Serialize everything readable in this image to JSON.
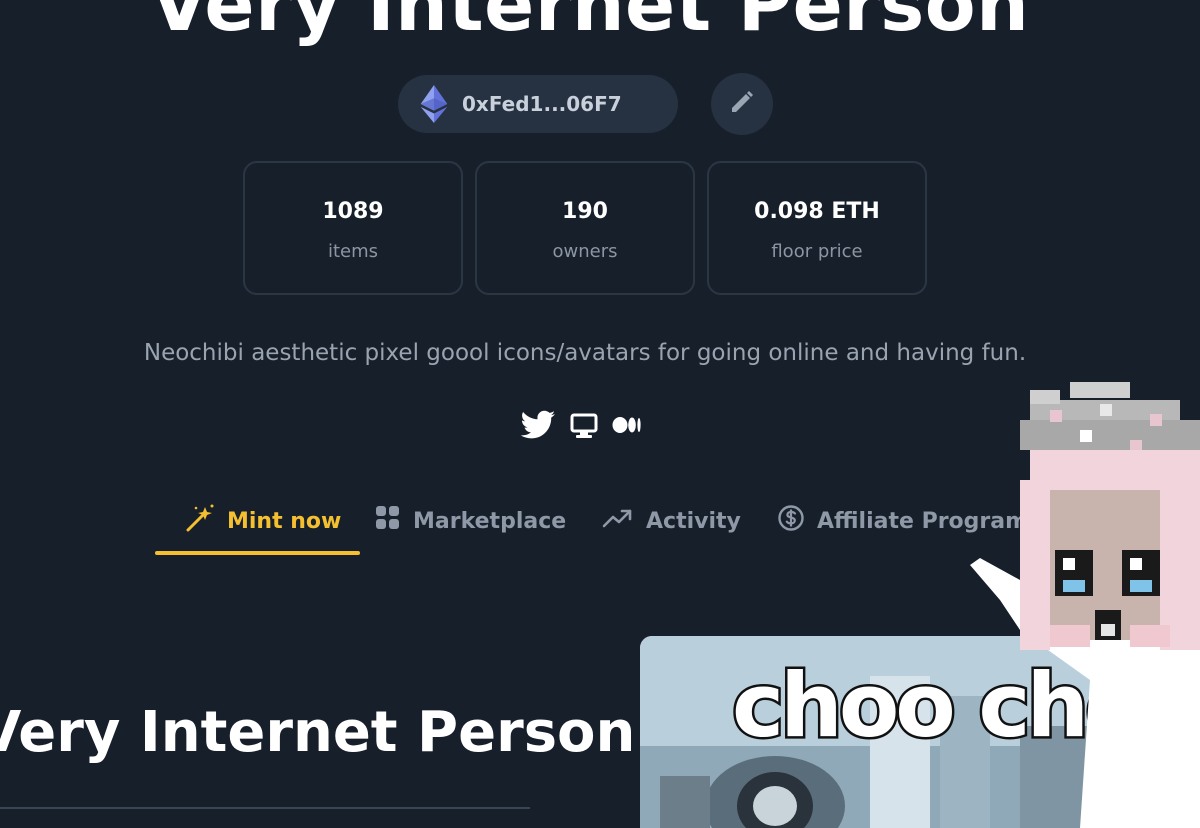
{
  "header": {
    "collection_title": "Very Internet Person",
    "wallet_address": "0xFed1...06F7",
    "wallet_icon": "ethereum-icon",
    "edit_icon": "pencil-icon"
  },
  "stats": [
    {
      "value": "1089",
      "label": "items"
    },
    {
      "value": "190",
      "label": "owners"
    },
    {
      "value": "0.098 ETH",
      "label": "floor price"
    }
  ],
  "description": "Neochibi aesthetic pixel goool icons/avatars for going online and having fun.",
  "social_links": [
    "twitter-icon",
    "website-icon",
    "medium-icon"
  ],
  "tabs": [
    {
      "label": "Mint now",
      "icon": "magic-wand-icon",
      "active": true
    },
    {
      "label": "Marketplace",
      "icon": "grid-icon",
      "active": false
    },
    {
      "label": "Activity",
      "icon": "trending-up-icon",
      "active": false
    },
    {
      "label": "Affiliate Program",
      "icon": "dollar-circle-icon",
      "active": false
    }
  ],
  "section": {
    "title": "Very Internet Person"
  },
  "preview": {
    "meme_text": "choo choo"
  },
  "colors": {
    "background": "#171f2a",
    "card_border": "#2b3645",
    "pill_background": "#263141",
    "accent": "#f5c030",
    "muted_text": "#8b95a3"
  }
}
